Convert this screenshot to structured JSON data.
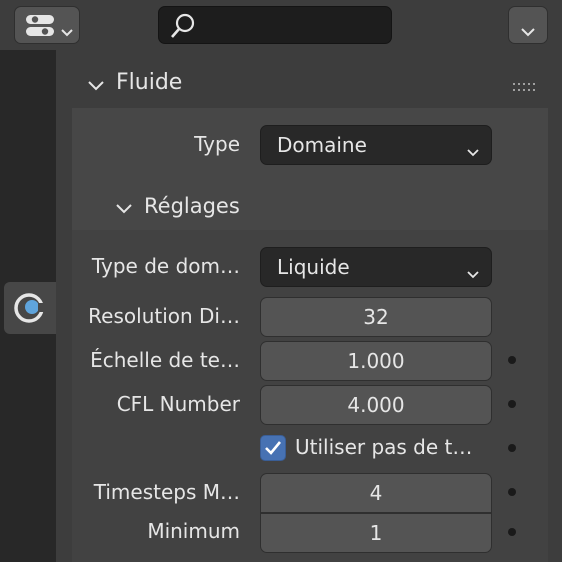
{
  "header": {
    "editor_type_icon": "properties-editor-icon",
    "search": {
      "value": "",
      "icon": "search-icon"
    },
    "options_icon": "chevron-down-icon"
  },
  "tabs": {
    "active": "physics",
    "icon": "physics-icon",
    "accent": "#5fa4dc"
  },
  "panel": {
    "title": "Fluide",
    "type": {
      "label": "Type",
      "value": "Domaine"
    },
    "subpanel": {
      "title": "Réglages",
      "rows": [
        {
          "label": "Type de dom…",
          "value": "Liquide"
        },
        {
          "label": "Resolution Di…",
          "value": "32"
        },
        {
          "label": "Échelle de te…",
          "value": "1.000"
        },
        {
          "label": "CFL Number",
          "value": "4.000"
        },
        {
          "label": "Utiliser pas de t…",
          "checked": true
        },
        {
          "label": "Timesteps M…",
          "value": "4"
        },
        {
          "label": "Minimum",
          "value": "1"
        }
      ]
    }
  },
  "colors": {
    "checkbox": "#4772b3",
    "field": "#545454",
    "dropdown": "#282828"
  }
}
